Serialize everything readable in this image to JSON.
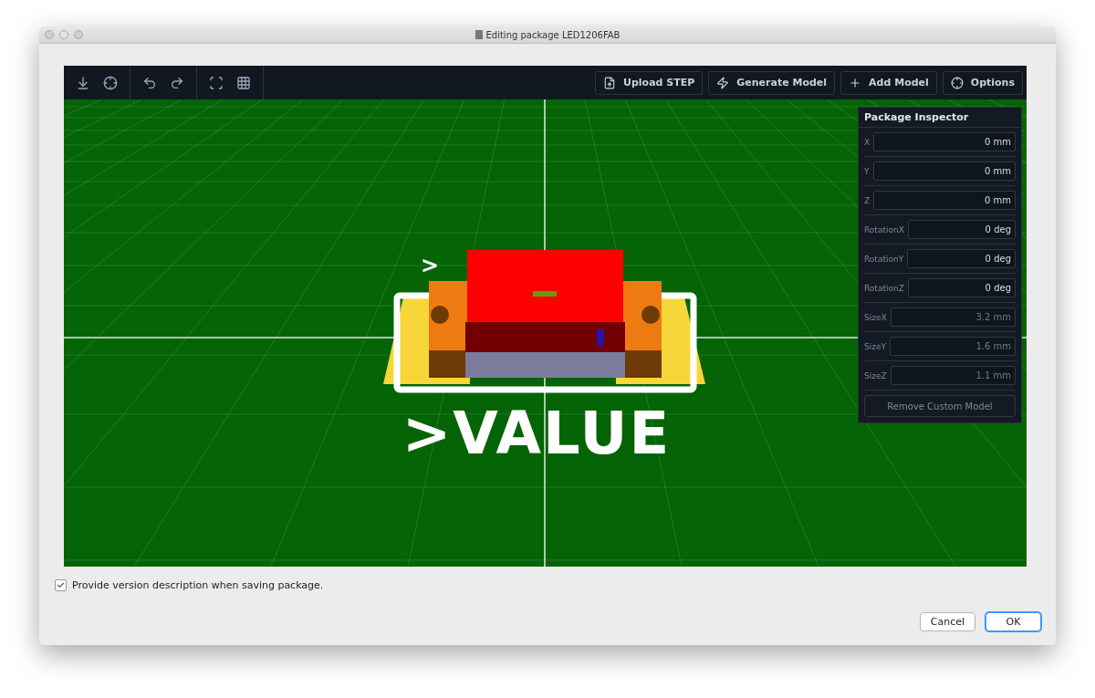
{
  "window": {
    "title": "Editing package LED1206FAB"
  },
  "toolbar": {
    "buttons": [
      {
        "label": "Upload STEP"
      },
      {
        "label": "Generate Model"
      },
      {
        "label": "Add Model"
      },
      {
        "label": "Options"
      }
    ]
  },
  "scene": {
    "labels": [
      ">",
      ">VALUE"
    ]
  },
  "inspector": {
    "title": "Package Inspector",
    "fields": [
      {
        "label": "X",
        "value": "0 mm",
        "disabled": false
      },
      {
        "label": "Y",
        "value": "0 mm",
        "disabled": false
      },
      {
        "label": "Z",
        "value": "0 mm",
        "disabled": false
      },
      {
        "label": "RotationX",
        "value": "0 deg",
        "disabled": false
      },
      {
        "label": "RotationY",
        "value": "0 deg",
        "disabled": false
      },
      {
        "label": "RotationZ",
        "value": "0 deg",
        "disabled": false
      },
      {
        "label": "SizeX",
        "value": "3.2 mm",
        "disabled": true
      },
      {
        "label": "SizeY",
        "value": "1.6 mm",
        "disabled": true
      },
      {
        "label": "SizeZ",
        "value": "1.1 mm",
        "disabled": true
      }
    ],
    "button": "Remove Custom Model"
  },
  "option": {
    "label": "Provide version description when saving package.",
    "checked": true
  },
  "buttons": [
    {
      "label": "Cancel",
      "default": false
    },
    {
      "label": "OK",
      "default": true
    }
  ]
}
